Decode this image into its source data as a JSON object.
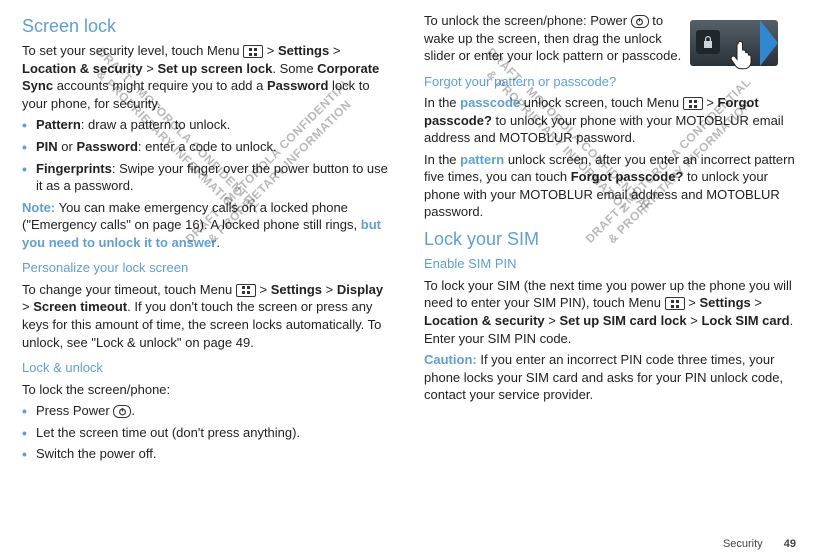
{
  "watermark": {
    "draft": "DRAFT - MOTOROLA CONFIDENTIAL\n& PROPRIETARY INFORMATION"
  },
  "footer": {
    "section": "Security",
    "page": "49"
  },
  "left": {
    "h_screen_lock": "Screen lock",
    "p_intro_1": "To set your security level, touch Menu ",
    "p_intro_2": " > ",
    "p_intro_settings": "Settings",
    "p_intro_3": " > ",
    "p_intro_loc": "Location & security",
    "p_intro_4": " > ",
    "p_intro_setup": "Set up screen lock",
    "p_intro_5": ". Some ",
    "p_intro_corp": "Corporate Sync",
    "p_intro_6": " accounts might require you to add a ",
    "p_intro_pwd": "Password",
    "p_intro_7": " lock to your phone, for security.",
    "li1_b": "Pattern",
    "li1_t": ": draw a pattern to unlock.",
    "li2_b1": "PIN",
    "li2_or": " or ",
    "li2_b2": "Password",
    "li2_t": ": enter a code to unlock.",
    "li3_b": "Fingerprints",
    "li3_t": ": Swipe your finger over the power button to use it as a password.",
    "note_lbl": "Note:",
    "note_t1": " You can make emergency calls on a locked phone (\"Emergency calls\" on page 16). A locked phone still rings, ",
    "note_link": "but you need to unlock it to answer",
    "note_t2": ".",
    "h_personalize": "Personalize your lock screen",
    "pers_1": "To change your timeout, touch Menu ",
    "pers_2": " > ",
    "pers_settings": "Settings",
    "pers_3": " > ",
    "pers_display": "Display",
    "pers_4": " > ",
    "pers_timeout": "Screen timeout",
    "pers_5": ". If you don't touch the screen or press any keys for this amount of time, the screen locks automatically. To unlock, see \"Lock & unlock\" on page 49.",
    "h_lockunlock": "Lock & unlock",
    "lu_intro": "To lock the screen/phone:",
    "lu_li1a": "Press Power ",
    "lu_li1b": ".",
    "lu_li2": "Let the screen time out (don't press anything).",
    "lu_li3": "Switch the power off."
  },
  "right": {
    "top1": "To unlock the screen/phone: Power ",
    "top2": " to wake up the screen, then drag the unlock slider or enter your lock pattern or passcode.",
    "h_forgot": "Forgot your pattern or passcode?",
    "fp_1a": "In the ",
    "fp_passcode": "passcode",
    "fp_1b": " unlock screen, touch Menu ",
    "fp_1c": " > ",
    "fp_forgot": "Forgot passcode?",
    "fp_1d": " to unlock your phone with your MOTOBLUR email address and MOTOBLUR password.",
    "fp_2a": "In the ",
    "fp_pattern": "pattern",
    "fp_2b": " unlock screen, after you enter an incorrect pattern five times, you can touch ",
    "fp_forgot2": "Forgot passcode?",
    "fp_2c": " to unlock your phone with your MOTOBLUR email address and MOTOBLUR password.",
    "h_locksim": "Lock your SIM",
    "h_enablesim": "Enable SIM PIN",
    "sim_1a": "To lock your SIM (the next time you power up the phone you will need to enter your SIM PIN), touch Menu ",
    "sim_1b": " > ",
    "sim_settings": "Settings",
    "sim_1c": " > ",
    "sim_loc": "Location & security",
    "sim_1d": " > ",
    "sim_setup": "Set up SIM card lock",
    "sim_1e": " > ",
    "sim_lock": "Lock SIM card",
    "sim_1f": ". Enter your SIM PIN code.",
    "caution_lbl": "Caution:",
    "caution_t": " If you enter an incorrect PIN code three times, your phone locks your SIM card and asks for your PIN unlock code, contact your service provider."
  }
}
